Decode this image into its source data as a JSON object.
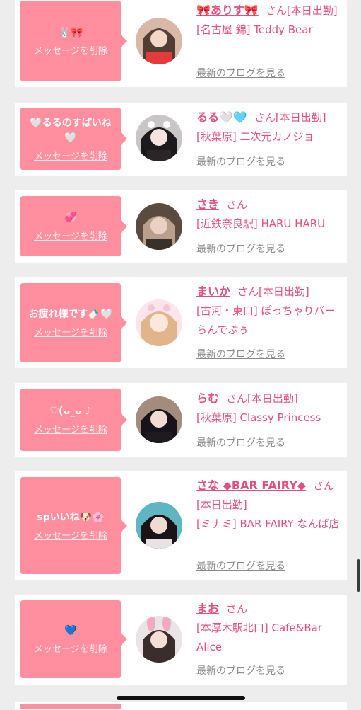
{
  "delete_label": "メッセージを削除",
  "san_label": "さん",
  "blog_label": "最新のブログを見る",
  "cards": [
    {
      "message": "🐰🎀",
      "name": "🎀ありす🎀",
      "status": "[本日出勤]",
      "shop": "[名古屋 錦] Teddy Bear"
    },
    {
      "message": "🤍るるのすぱいね🤍",
      "name": "るる🤍🩵",
      "status": "[本日出勤]",
      "shop": "[秋葉原] 二次元カノジョ"
    },
    {
      "message": "💞",
      "name": "さき",
      "status": "",
      "shop": "[近鉄奈良駅] HARU HARU"
    },
    {
      "message": "お疲れ様です🍼🤍",
      "name": "まいか",
      "status": "[本日出勤]",
      "shop": "[古河・東口] ぽっちゃりバー らんでぶぅ"
    },
    {
      "message": "♡(ᴗ_ᴗ ♪",
      "name": "らむ",
      "status": "[本日出勤]",
      "shop": "[秋葉原] Classy Princess"
    },
    {
      "message": "spいいね🐶🌸",
      "name": "さな ◆BAR FAIRY◆",
      "status": "[本日出勤]",
      "shop": "[ミナミ] BAR FAIRY なんば店"
    },
    {
      "message": "💙",
      "name": "まお",
      "status": "",
      "shop": "[本厚木駅北口] Cafe&Bar Alice"
    }
  ]
}
